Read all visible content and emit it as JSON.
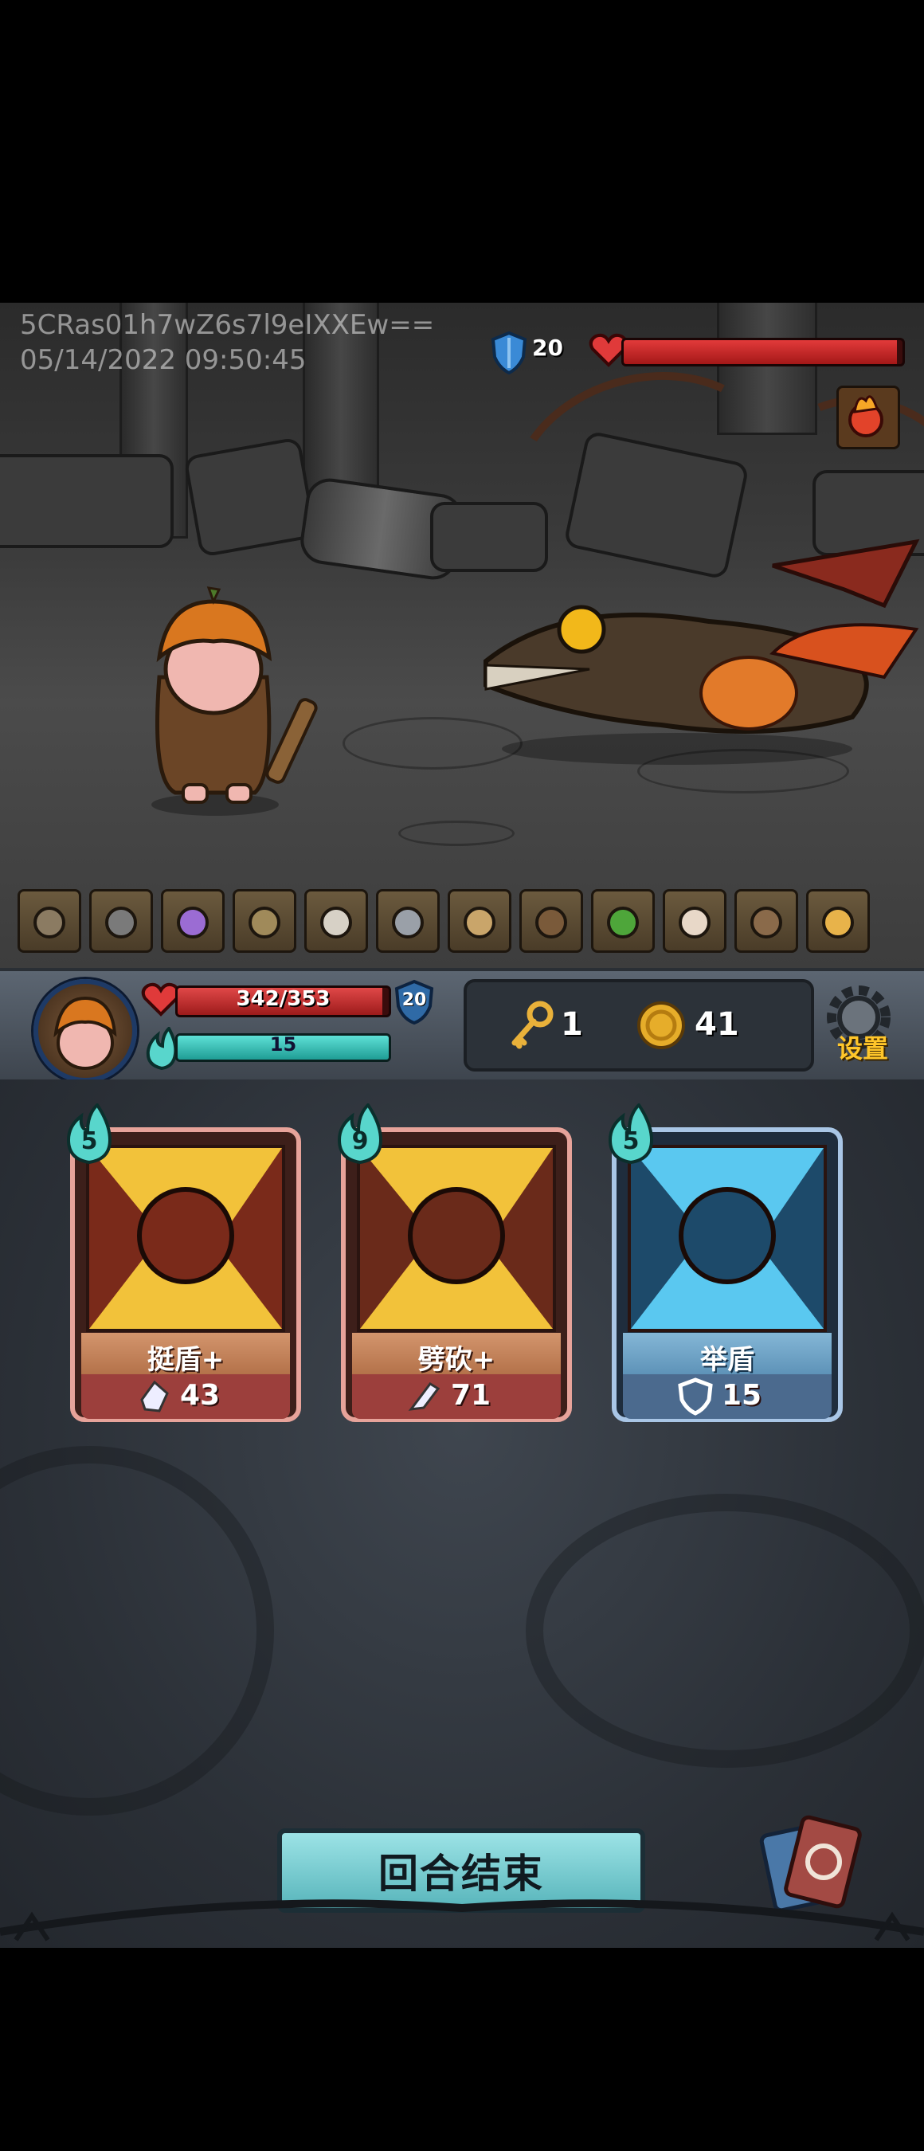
{
  "watermark": {
    "line1": "5CRas01h7wZ6s7l9eIXXEw==",
    "line2": "05/14/2022 09:50:45"
  },
  "enemy": {
    "block_icon": "shield-icon",
    "block": "20",
    "hp_icon": "heart-icon",
    "hp_fraction": 0.98,
    "intent_icon": "fire-orb-icon",
    "name_icon": "dragon-enemy"
  },
  "relics": [
    {
      "icon": "bag-relic-icon"
    },
    {
      "icon": "trap-relic-icon"
    },
    {
      "icon": "potion-jar-relic-icon"
    },
    {
      "icon": "shovel-relic-icon"
    },
    {
      "icon": "claw-relic-icon"
    },
    {
      "icon": "helmet-relic-icon"
    },
    {
      "icon": "scroll-relic-icon"
    },
    {
      "icon": "bear-relic-icon"
    },
    {
      "icon": "green-gem-relic-icon"
    },
    {
      "icon": "bone-relic-icon"
    },
    {
      "icon": "chest-relic-icon"
    },
    {
      "icon": "horn-relic-icon"
    }
  ],
  "player": {
    "avatar_icon": "pumpkin-hero-avatar",
    "hp_text": "342/353",
    "hp_fraction": 0.969,
    "block": "20",
    "energy_text": "15",
    "energy_fraction": 1.0
  },
  "resources": {
    "keys": "1",
    "coins": "41"
  },
  "settings_label": "设置",
  "cards": [
    {
      "cost": "5",
      "title": "挺盾+",
      "stat": "43",
      "stat_icon": "crystal-shard-icon",
      "art": "shield-burst-art",
      "theme": "red"
    },
    {
      "cost": "9",
      "title": "劈砍+",
      "stat": "71",
      "stat_icon": "slash-claw-icon",
      "art": "axe-art",
      "theme": "red"
    },
    {
      "cost": "5",
      "title": "举盾",
      "stat": "15",
      "stat_icon": "shield-outline-icon",
      "art": "knight-art",
      "theme": "blue"
    }
  ],
  "end_turn_label": "回合结束",
  "colors": {
    "hp": "#d63636",
    "energy": "#3fc9bf",
    "gold": "#ffc62a",
    "card_red": "#e7a39a",
    "card_blue": "#a9c6e6"
  }
}
